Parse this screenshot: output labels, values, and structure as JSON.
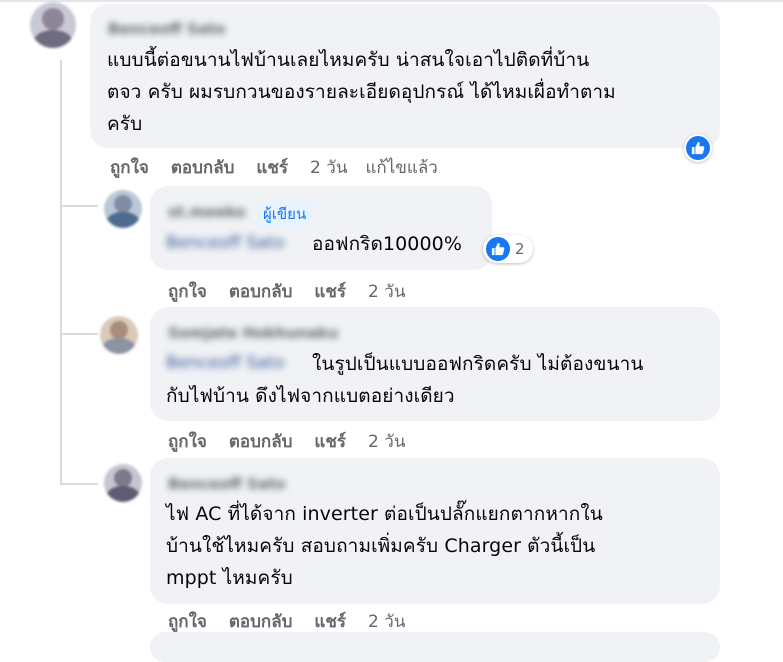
{
  "comment1": {
    "author": "Benceoff Sato",
    "text": "แบบนี้ต่อขนานไฟบ้านเลยไหมครับ น่าสนใจเอาไปติดที่บ้าน\nตจว ครับ ผมรบกวนของรายละเอียดอุปกรณ์ ได้ไหมเผื่อทำตาม\nครับ",
    "actions": {
      "like": "ถูกใจ",
      "reply": "ตอบกลับ",
      "share": "แชร์"
    },
    "time": "2 วัน",
    "edited": "แก้ไขแล้ว",
    "reaction_icon": "like-icon"
  },
  "reply1": {
    "author": "st.meeko",
    "author_badge": "ผู้เขียน",
    "mention": "Benceoff Sato",
    "text": "ออฟกริด10000%",
    "reaction_count": "2",
    "actions": {
      "like": "ถูกใจ",
      "reply": "ตอบกลับ",
      "share": "แชร์"
    },
    "time": "2 วัน"
  },
  "reply2": {
    "author": "Somjate Hokhunaku",
    "mention": "Benceoff Sato",
    "text": "ในรูปเป็นแบบออฟกริดครับ ไม่ต้องขนาน\nกับไฟบ้าน ดึงไฟจากแบตอย่างเดียว",
    "actions": {
      "like": "ถูกใจ",
      "reply": "ตอบกลับ",
      "share": "แชร์"
    },
    "time": "2 วัน"
  },
  "reply3": {
    "author": "Benceoff Sato",
    "text": "ไฟ AC ที่ได้จาก inverter ต่อเป็นปลั๊กแยกตากหากใน\nบ้านใช้ไหมครับ สอบถามเพิ่มครับ Charger ตัวนี้เป็น\nmppt ไหมครับ",
    "actions": {
      "like": "ถูกใจ",
      "reply": "ตอบกลับ",
      "share": "แชร์"
    },
    "time": "2 วัน"
  },
  "colors": {
    "bubble": "#f0f2f5",
    "action_text": "#65676b",
    "like_blue": "#1877f2",
    "badge_bg": "#e7f3ff"
  }
}
